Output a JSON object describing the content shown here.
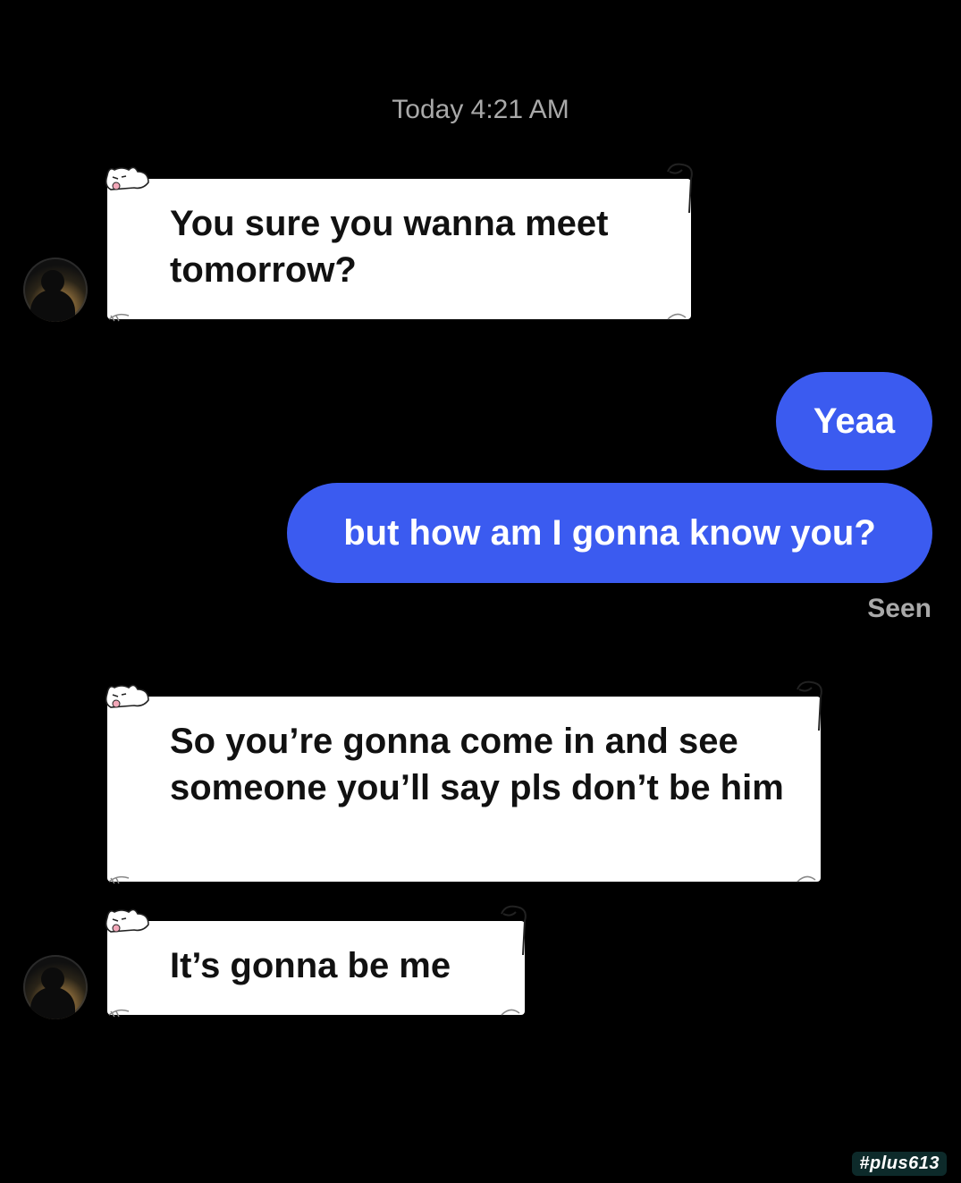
{
  "conversation": {
    "timestamp": "Today 4:21 AM",
    "messages": [
      {
        "direction": "incoming",
        "text": "You sure you wanna meet tomorrow?"
      },
      {
        "direction": "outgoing",
        "text": "Yeaa"
      },
      {
        "direction": "outgoing",
        "text": "but how am I gonna know you?"
      },
      {
        "direction": "incoming",
        "text": "So you’re gonna come in and see someone you’ll say pls don’t be him"
      },
      {
        "direction": "incoming",
        "text": "It’s gonna be me"
      }
    ],
    "read_receipt": "Seen"
  },
  "watermark": "#plus613",
  "colors": {
    "background": "#000000",
    "outgoing_bubble": "#3b5bf0",
    "incoming_bubble": "#ffffff",
    "meta_text": "#a9a9a9"
  },
  "icons": {
    "bubble_decoration": "cat-doodle-icon",
    "avatar": "user-avatar"
  }
}
